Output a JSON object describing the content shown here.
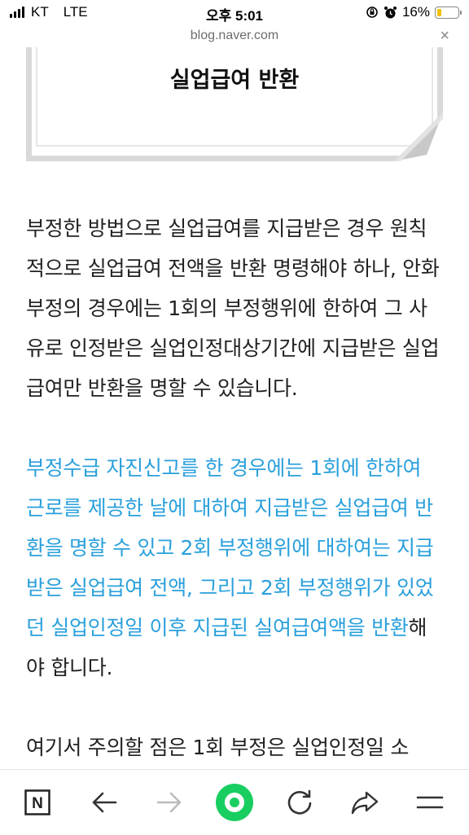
{
  "status_bar": {
    "carrier": "KT",
    "network": "LTE",
    "time": "오후 5:01",
    "battery": "16%",
    "battery_color": "#f5c000"
  },
  "browser": {
    "url": "blog.naver.com",
    "close_label": "×"
  },
  "post": {
    "section_title": "실업급여 반환",
    "paragraphs": [
      {
        "text": "부정한 방법으로 실업급여를 지급받은 경우 원칙적으로 실업급여 전액을 반환 명령해야 하나, 안화부정의 경우에는 1회의 부정행위에 한하여 그 사유로 인정받은 실업인정대상기간에 지급받은 실업급여만 반환을 명할 수 있습니다."
      },
      {
        "highlight": "부정수급 자진신고를 한 경우에는 1회에 한하여 근로를 제공한 날에 대하여 지급받은 실업급여 반환을 명할 수 있고 2회 부정행위에 대하여는 지급받은 실업급여 전액, 그리고 2회 부정행위가 있었던 실업인정일 이후 지급된 실여급여액을 반환",
        "tail": "해야 합니다.",
        "highlight_color": "#2aa0dc"
      },
      {
        "text": "여기서 주의할 점은 1회 부정은 실업인정일 소"
      }
    ]
  },
  "toolbar": {
    "naver_label": "N",
    "green_accent": "#19ce60",
    "icons": [
      "naver-home-icon",
      "back-arrow-icon",
      "forward-arrow-icon",
      "green-circle-icon",
      "refresh-icon",
      "share-icon",
      "menu-icon"
    ]
  }
}
